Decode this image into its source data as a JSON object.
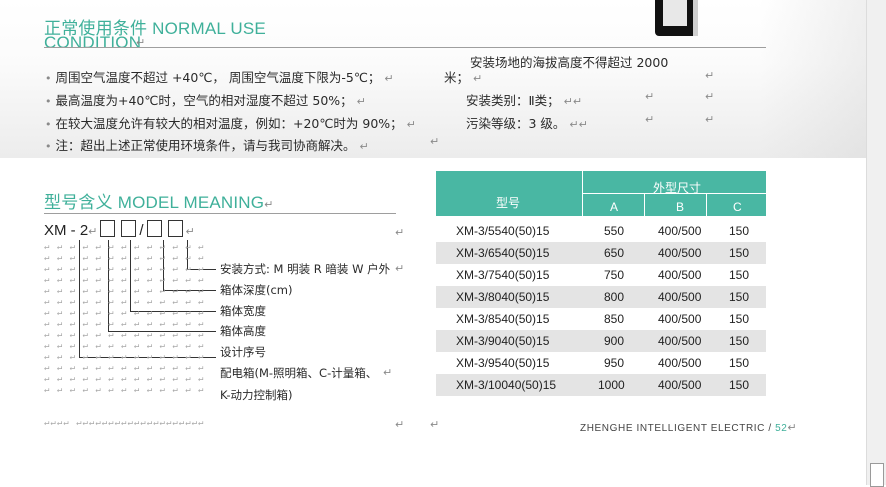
{
  "section1": {
    "title_line1": "正常使用条件 NORMAL USE",
    "title_line2": "CONDITION",
    "items_left": [
      "周围空气温度不超过 +40℃， 周围空气温度下限为-5℃；",
      "最高温度为+40℃时，空气的相对湿度不超过 50%；",
      "在较大温度允许有较大的相对温度，例如：+20℃时为 90%；",
      "注：超出上述正常使用环境条件，请与我司协商解决。"
    ],
    "item_right_1a": "安装场地的海拔高度不得超过 2000",
    "item_right_1b": "米；",
    "item_right_2": "安装类别：Ⅱ类；",
    "item_right_3": "污染等级：3 级。"
  },
  "section2": {
    "title": "型号含义 MODEL MEANING",
    "model_prefix": "XM - 2",
    "model_slash": "/",
    "labels": [
      "安装方式: M 明装 R 暗装 W 户外",
      "箱体深度(cm)",
      "箱体宽度",
      "箱体高度",
      "设计序号",
      "配电箱(M-照明箱、C-计量箱、",
      "K-动力控制箱)"
    ]
  },
  "table": {
    "header_model": "型号",
    "header_dims": "外型尺寸",
    "col_a": "A",
    "col_b": "B",
    "col_c": "C",
    "rows": [
      {
        "model": "XM-3/5540(50)15",
        "a": "550",
        "b": "400/500",
        "c": "150"
      },
      {
        "model": "XM-3/6540(50)15",
        "a": "650",
        "b": "400/500",
        "c": "150"
      },
      {
        "model": "XM-3/7540(50)15",
        "a": "750",
        "b": "400/500",
        "c": "150"
      },
      {
        "model": "XM-3/8040(50)15",
        "a": "800",
        "b": "400/500",
        "c": "150"
      },
      {
        "model": "XM-3/8540(50)15",
        "a": "850",
        "b": "400/500",
        "c": "150"
      },
      {
        "model": "XM-3/9040(50)15",
        "a": "900",
        "b": "400/500",
        "c": "150"
      },
      {
        "model": "XM-3/9540(50)15",
        "a": "950",
        "b": "400/500",
        "c": "150"
      },
      {
        "model": "XM-3/10040(50)15",
        "a": "1000",
        "b": "400/500",
        "c": "150"
      }
    ]
  },
  "footer": {
    "company": "ZHENGHE INTELLIGENT ELECTRIC /",
    "page": "52"
  },
  "colors": {
    "accent": "#3fb09a",
    "table_header": "#49b7a3",
    "row_alt": "#e4e4e4"
  }
}
